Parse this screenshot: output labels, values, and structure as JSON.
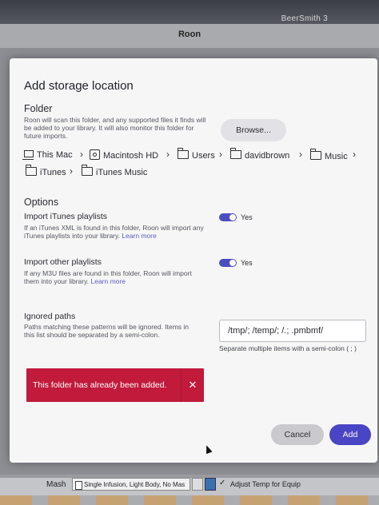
{
  "top": {
    "app_label": "BeerSmith 3",
    "window_title": "Roon"
  },
  "dialog": {
    "title": "Add storage location",
    "folder": {
      "heading": "Folder",
      "description": "Roon will scan this folder, and any supported files it finds will be added to your library. It will also monitor this folder for future imports.",
      "browse_label": "Browse...",
      "path": [
        "This Mac",
        "Macintosh HD",
        "Users",
        "davidbrown",
        "Music",
        "iTunes",
        "iTunes Music"
      ]
    },
    "options": {
      "heading": "Options",
      "itunes": {
        "label": "Import iTunes playlists",
        "description": "If an iTunes XML is found in this folder, Roon will import any iTunes playlists into your library.",
        "link": "Learn more",
        "toggle_label": "Yes"
      },
      "other": {
        "label": "Import other playlists",
        "description": "If any M3U files are found in this folder, Roon will import them into your library.",
        "link": "Learn more",
        "toggle_label": "Yes"
      }
    },
    "ignored": {
      "heading": "Ignored paths",
      "description": "Paths matching these patterns will be ignored. Items in this list should be separated by a semi-colon.",
      "value": "/tmp/; /temp/; /.; .pmbmf/",
      "hint": "Separate multiple items with a semi-colon ( ; )"
    },
    "error": {
      "message": "This folder has already been added.",
      "close_glyph": "✕"
    },
    "buttons": {
      "cancel": "Cancel",
      "add": "Add"
    }
  },
  "bottom": {
    "mash_label": "Mash",
    "mash_profile": "Single Infusion, Light Body, No Mas",
    "adjust_label": "Adjust Temp for Equip",
    "adjust_checked": true
  }
}
